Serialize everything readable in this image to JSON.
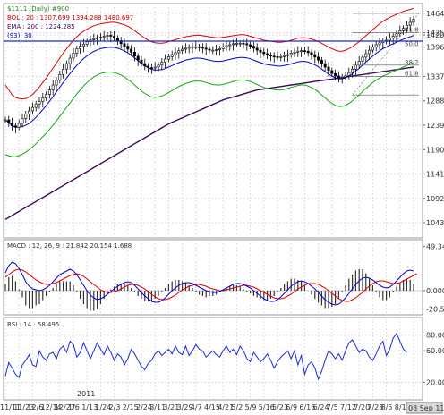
{
  "chart_data": [
    {
      "type": "candlestick",
      "panel": "main",
      "title": "$1111 (Daily) #900",
      "legend": [
        {
          "label": "BOL : 20 : 1307.699 1394.288 1480.697",
          "color": "#d00000"
        },
        {
          "label": "EMA : 200 : 1224.285",
          "color": "#3a0a5a"
        },
        {
          "label": "(93), 30",
          "color": "#0000cc"
        }
      ],
      "y_ticks": [
        "1464.20",
        "1425.10",
        "1420.50",
        "1396.20",
        "1337.20",
        "1288.20",
        "1239.20",
        "1190.20",
        "1141.20",
        "1092.20",
        "1043.20"
      ],
      "ylim": [
        1020,
        1480
      ],
      "fib_labels": [
        "61.8",
        "50.0",
        "38.2",
        "61.8"
      ],
      "close": [
        1250,
        1244,
        1238,
        1235,
        1243,
        1253,
        1262,
        1268,
        1275,
        1282,
        1287,
        1294,
        1301,
        1310,
        1320,
        1330,
        1341,
        1352,
        1363,
        1374,
        1384,
        1393,
        1398,
        1402,
        1407,
        1411,
        1413,
        1415,
        1416,
        1418,
        1420,
        1418,
        1414,
        1409,
        1403,
        1398,
        1392,
        1386,
        1378,
        1370,
        1363,
        1358,
        1355,
        1354,
        1356,
        1360,
        1366,
        1372,
        1377,
        1381,
        1385,
        1389,
        1392,
        1394,
        1396,
        1397,
        1397,
        1396,
        1394,
        1392,
        1390,
        1390,
        1391,
        1393,
        1396,
        1399,
        1401,
        1403,
        1404,
        1404,
        1403,
        1401,
        1398,
        1394,
        1390,
        1386,
        1383,
        1380,
        1378,
        1377,
        1376,
        1377,
        1379,
        1381,
        1384,
        1386,
        1388,
        1389,
        1388,
        1385,
        1381,
        1376,
        1370,
        1363,
        1356,
        1349,
        1343,
        1338,
        1335,
        1336,
        1339,
        1345,
        1352,
        1360,
        1368,
        1376,
        1383,
        1390,
        1396,
        1401,
        1405,
        1408,
        1410,
        1414,
        1418,
        1423,
        1429,
        1434,
        1440,
        1446,
        1452
      ],
      "upper_band": [
        1320,
        1310,
        1300,
        1295,
        1293,
        1292,
        1293,
        1296,
        1301,
        1308,
        1316,
        1325,
        1334,
        1344,
        1354,
        1364,
        1374,
        1384,
        1393,
        1402,
        1410,
        1417,
        1423,
        1428,
        1432,
        1436,
        1439,
        1441,
        1443,
        1444,
        1445,
        1446,
        1446,
        1445,
        1443,
        1441,
        1438,
        1434,
        1429,
        1424,
        1419,
        1414,
        1410,
        1407,
        1405,
        1404,
        1404,
        1405,
        1407,
        1409,
        1411,
        1413,
        1415,
        1417,
        1418,
        1419,
        1420,
        1420,
        1419,
        1418,
        1417,
        1416,
        1415,
        1415,
        1416,
        1417,
        1418,
        1419,
        1420,
        1421,
        1421,
        1420,
        1418,
        1416,
        1414,
        1412,
        1410,
        1409,
        1408,
        1407,
        1406,
        1406,
        1407,
        1408,
        1410,
        1412,
        1414,
        1415,
        1415,
        1414,
        1412,
        1410,
        1407,
        1404,
        1400,
        1396,
        1393,
        1390,
        1388,
        1388,
        1390,
        1393,
        1397,
        1402,
        1407,
        1413,
        1419,
        1425,
        1431,
        1437,
        1443,
        1448,
        1452,
        1456,
        1459,
        1462,
        1465,
        1468,
        1470,
        1472,
        1474
      ],
      "lower_band": [
        1180,
        1178,
        1176,
        1176,
        1178,
        1181,
        1185,
        1190,
        1196,
        1202,
        1209,
        1216,
        1223,
        1231,
        1239,
        1248,
        1257,
        1266,
        1275,
        1284,
        1293,
        1302,
        1310,
        1318,
        1325,
        1331,
        1336,
        1340,
        1343,
        1345,
        1346,
        1346,
        1345,
        1343,
        1340,
        1336,
        1331,
        1326,
        1320,
        1314,
        1308,
        1303,
        1299,
        1296,
        1295,
        1296,
        1298,
        1301,
        1305,
        1309,
        1313,
        1317,
        1320,
        1323,
        1325,
        1327,
        1328,
        1328,
        1327,
        1325,
        1323,
        1321,
        1320,
        1320,
        1321,
        1323,
        1325,
        1327,
        1329,
        1330,
        1330,
        1329,
        1327,
        1324,
        1321,
        1318,
        1315,
        1313,
        1312,
        1311,
        1310,
        1310,
        1311,
        1313,
        1315,
        1317,
        1319,
        1320,
        1320,
        1318,
        1315,
        1311,
        1306,
        1300,
        1294,
        1288,
        1283,
        1279,
        1277,
        1277,
        1279,
        1283,
        1288,
        1294,
        1300,
        1307,
        1313,
        1319,
        1325,
        1330,
        1334,
        1338,
        1341,
        1344,
        1347,
        1350,
        1353,
        1356,
        1359,
        1362,
        1365
      ],
      "ema200": [
        1050,
        1054,
        1058,
        1062,
        1066,
        1070,
        1074,
        1078,
        1082,
        1086,
        1090,
        1094,
        1098,
        1102,
        1106,
        1110,
        1114,
        1118,
        1122,
        1126,
        1130,
        1134,
        1138,
        1142,
        1146,
        1150,
        1154,
        1158,
        1162,
        1166,
        1170,
        1174,
        1178,
        1182,
        1186,
        1190,
        1194,
        1198,
        1202,
        1206,
        1210,
        1214,
        1218,
        1222,
        1226,
        1230,
        1234,
        1238,
        1242,
        1245,
        1248,
        1251,
        1254,
        1257,
        1260,
        1263,
        1266,
        1269,
        1272,
        1275,
        1278,
        1281,
        1284,
        1287,
        1290,
        1292,
        1294,
        1296,
        1298,
        1300,
        1302,
        1304,
        1306,
        1308,
        1310,
        1311,
        1312,
        1313,
        1314,
        1315,
        1316,
        1317,
        1318,
        1319,
        1320,
        1321,
        1322,
        1323,
        1324,
        1325,
        1326,
        1327,
        1328,
        1329,
        1330,
        1331,
        1332,
        1333,
        1334,
        1335,
        1336,
        1337,
        1338,
        1339,
        1340,
        1341,
        1342,
        1343,
        1344,
        1345,
        1346,
        1347,
        1348,
        1349,
        1350,
        1351,
        1352,
        1353,
        1354,
        1355,
        1356
      ]
    },
    {
      "type": "line",
      "panel": "macd",
      "legend_label": "MACD : 12, 26, 9 : 21.842 20.154 1.688",
      "y_ticks": [
        "49.341",
        "0.000",
        "-20.554"
      ],
      "ylim": [
        -25,
        55
      ],
      "macd": [
        20,
        28,
        32,
        30,
        25,
        18,
        10,
        5,
        2,
        1,
        0,
        1,
        3,
        6,
        10,
        14,
        18,
        20,
        22,
        24,
        22,
        18,
        12,
        6,
        0,
        -5,
        -8,
        -10,
        -9,
        -7,
        -4,
        -1,
        2,
        5,
        7,
        9,
        10,
        9,
        6,
        2,
        -2,
        -6,
        -9,
        -12,
        -13,
        -13,
        -11,
        -8,
        -4,
        0,
        3,
        6,
        8,
        9,
        9,
        8,
        6,
        4,
        2,
        0,
        -1,
        -2,
        -2,
        -1,
        1,
        3,
        5,
        7,
        8,
        8,
        7,
        5,
        3,
        0,
        -3,
        -6,
        -9,
        -11,
        -12,
        -12,
        -10,
        -7,
        -3,
        1,
        5,
        8,
        10,
        11,
        10,
        8,
        5,
        2,
        -2,
        -6,
        -10,
        -13,
        -15,
        -16,
        -15,
        -12,
        -8,
        -3,
        2,
        7,
        11,
        14,
        15,
        14,
        12,
        9,
        6,
        4,
        3,
        4,
        7,
        11,
        15,
        19,
        22,
        23,
        22
      ],
      "signal": [
        15,
        18,
        21,
        23,
        24,
        23,
        21,
        18,
        15,
        12,
        10,
        8,
        7,
        7,
        8,
        9,
        11,
        13,
        15,
        17,
        18,
        19,
        18,
        16,
        13,
        10,
        7,
        4,
        1,
        -1,
        -2,
        -2,
        -1,
        0,
        2,
        4,
        6,
        7,
        7,
        6,
        4,
        2,
        -1,
        -4,
        -7,
        -9,
        -10,
        -10,
        -9,
        -7,
        -5,
        -2,
        1,
        3,
        5,
        6,
        7,
        7,
        6,
        5,
        3,
        2,
        1,
        0,
        0,
        1,
        2,
        3,
        4,
        5,
        6,
        6,
        5,
        4,
        2,
        0,
        -2,
        -4,
        -6,
        -8,
        -9,
        -9,
        -8,
        -6,
        -4,
        -1,
        2,
        4,
        6,
        8,
        8,
        8,
        7,
        5,
        3,
        0,
        -3,
        -6,
        -9,
        -11,
        -12,
        -12,
        -10,
        -8,
        -5,
        -2,
        2,
        5,
        8,
        10,
        11,
        11,
        10,
        9,
        8,
        8,
        9,
        11,
        13,
        15,
        17,
        19
      ]
    },
    {
      "type": "line",
      "panel": "rsi",
      "legend_label": "RSI : 14 : 58.495",
      "y_ticks": [
        "80.000",
        "60.000",
        "20.000"
      ],
      "ylim": [
        0,
        100
      ],
      "values": [
        28,
        45,
        38,
        30,
        26,
        42,
        48,
        55,
        42,
        40,
        60,
        52,
        48,
        56,
        58,
        50,
        62,
        66,
        58,
        72,
        68,
        52,
        58,
        70,
        60,
        50,
        60,
        70,
        62,
        55,
        66,
        58,
        48,
        56,
        52,
        42,
        50,
        62,
        56,
        48,
        40,
        36,
        44,
        48,
        56,
        60,
        54,
        58,
        62,
        56,
        66,
        58,
        55,
        66,
        54,
        60,
        68,
        62,
        60,
        52,
        56,
        60,
        55,
        52,
        60,
        66,
        58,
        62,
        55,
        66,
        60,
        50,
        46,
        58,
        52,
        46,
        50,
        56,
        48,
        38,
        46,
        52,
        56,
        60,
        50,
        60,
        42,
        54,
        30,
        42,
        46,
        38,
        24,
        34,
        48,
        60,
        56,
        50,
        56,
        48,
        60,
        70,
        74,
        66,
        58,
        62,
        60,
        52,
        48,
        56,
        66,
        72,
        54,
        62,
        76,
        82,
        72,
        62,
        58
      ],
      "last_label": "58.495"
    }
  ],
  "x_axis": {
    "ticks": [
      "11/11",
      "11/23",
      "12/6",
      "12/14",
      "12/27",
      "1/6",
      "1/13",
      "1/24",
      "2/3",
      "2/15",
      "2/24",
      "3/11",
      "3/21",
      "3/29",
      "4/7",
      "4/15",
      "4/21",
      "5/2",
      "5/9",
      "5/16",
      "5/23",
      "6/9",
      "6/16",
      "6/24",
      "7/5",
      "7/12",
      "7/20",
      "7/28",
      "8/5",
      "8/12",
      "8/22"
    ],
    "year_label": "2011",
    "last_date_label": "08 Sep 11"
  },
  "colors": {
    "candle": "#000000",
    "upper_band": "#dd0000",
    "ma20": "#0000cc",
    "lower_band": "#11aa11",
    "ema": "#3a0a5a",
    "macd_line": "#0000cc",
    "macd_signal": "#dd0000",
    "rsi_line": "#1a2ad4",
    "resistance": "#1a2ad4",
    "grid": "#dddddd"
  }
}
